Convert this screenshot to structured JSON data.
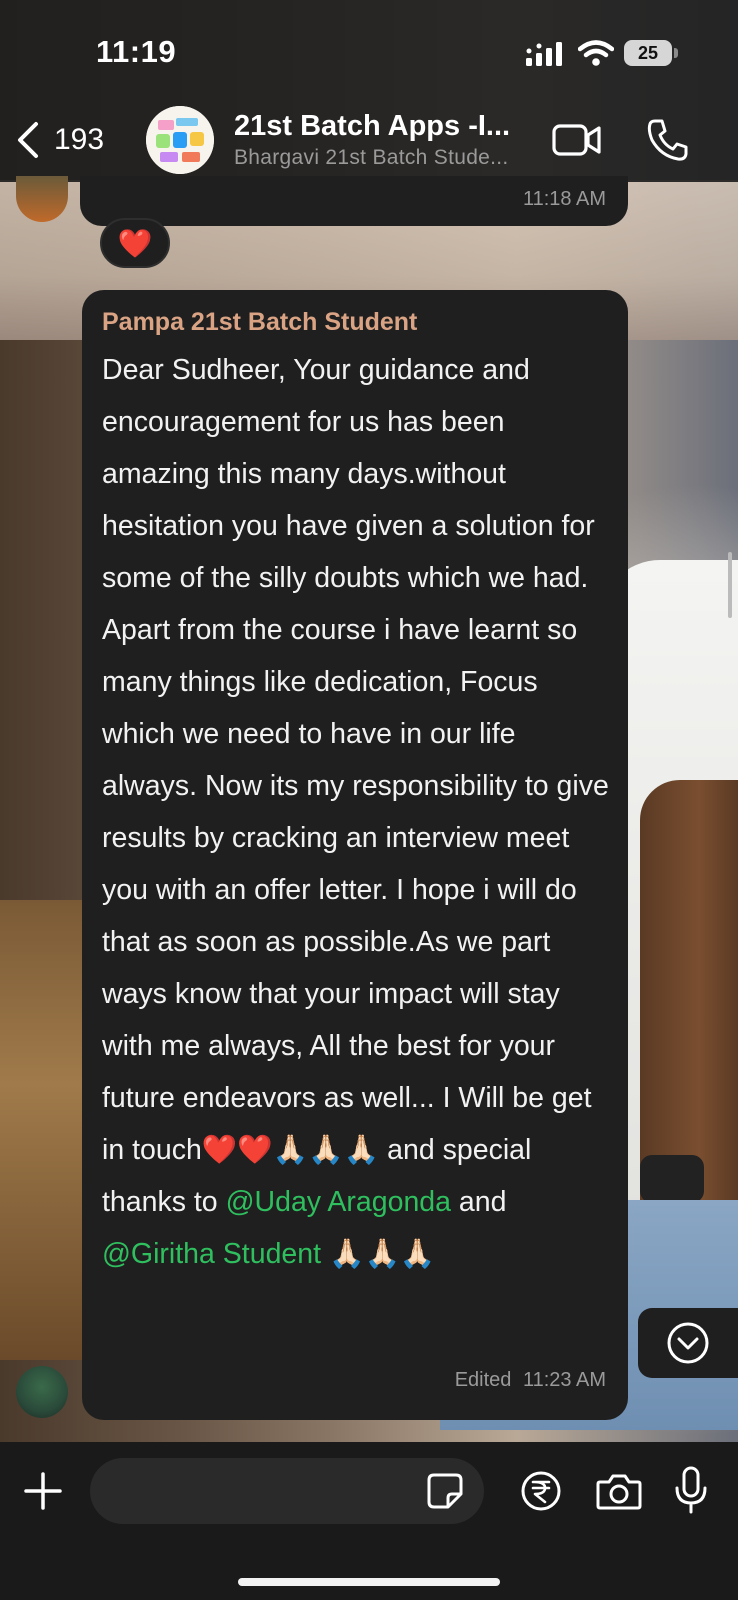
{
  "status_bar": {
    "time": "11:19",
    "battery": "25"
  },
  "header": {
    "back_count": "193",
    "title": "21st Batch Apps -I...",
    "subtitle": "Bhargavi 21st Batch Stude..."
  },
  "previous_message": {
    "time": "11:18 AM",
    "reaction": "❤️"
  },
  "message": {
    "sender": "Pampa 21st Batch Student",
    "text_before_mention": "Dear Sudheer, Your guidance and encouragement  for us has been amazing this many days.without hesitation you have given a solution for some of the silly doubts which we had. Apart from the course i have learnt so many things like dedication, Focus which we need to have in our life always. Now its my responsibility to give results by cracking an interview meet you with an offer letter. I hope i will do that as soon as possible.As we part ways know that your impact will stay with me always, All the best for your future endeavors as well... I Will be get in touch❤️❤️🙏🏻🙏🏻🙏🏻 and special thanks to ",
    "mention_1": "@Uday Aragonda",
    "between_mentions": "  and ",
    "mention_2": "@Giritha Student",
    "text_after_mention": " 🙏🏻🙏🏻🙏🏻",
    "edited_label": "Edited",
    "time": "11:23 AM"
  },
  "input": {
    "placeholder": ""
  },
  "colors": {
    "bubble": "#1f1f1f",
    "sender_name": "#d9a384",
    "mention": "#2fbf5f",
    "meta_text": "#9a9a9a"
  },
  "icons": {
    "back": "chevron-left-icon",
    "video": "video-camera-icon",
    "call": "phone-icon",
    "scroll": "chevron-down-circle-icon",
    "plus": "plus-icon",
    "sticker": "sticker-icon",
    "rupee": "rupee-payment-icon",
    "camera": "camera-icon",
    "mic": "microphone-icon"
  }
}
